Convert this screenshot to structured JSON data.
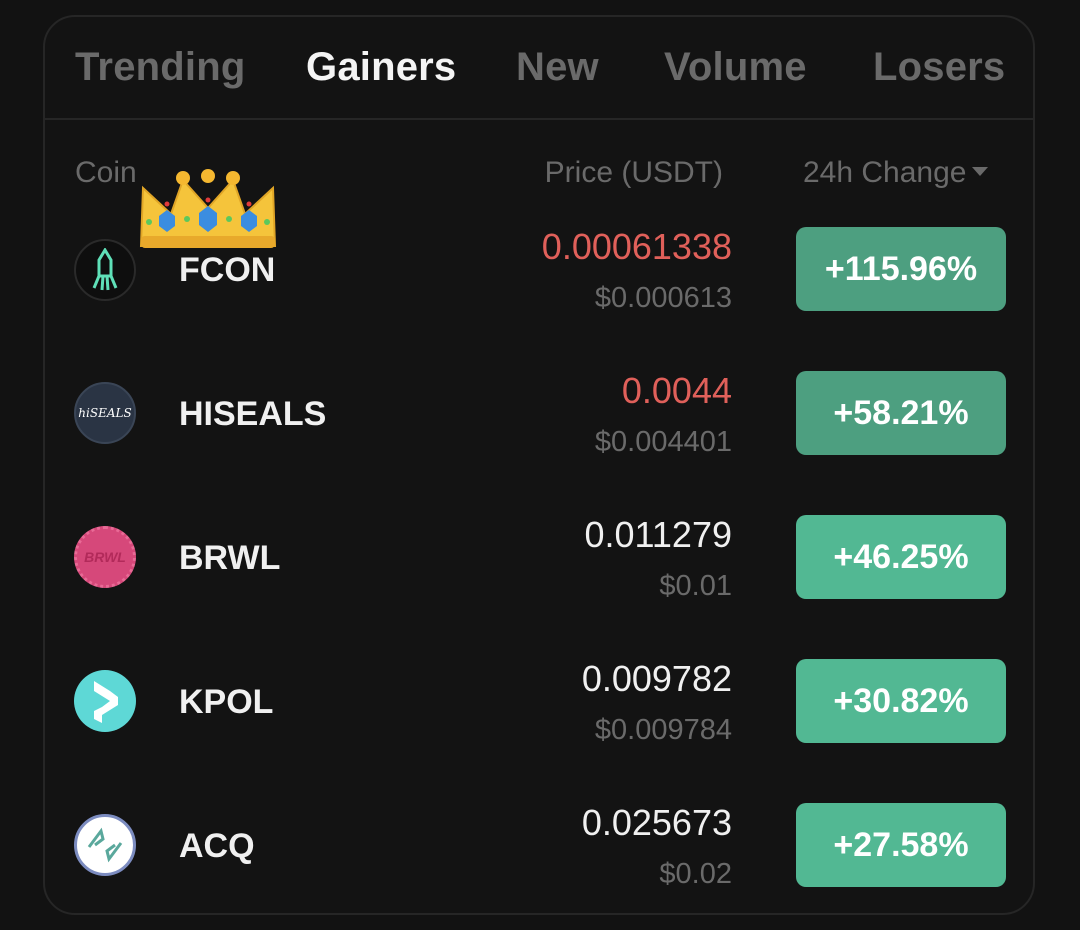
{
  "tabs": [
    {
      "label": "Trending",
      "active": false
    },
    {
      "label": "Gainers",
      "active": true
    },
    {
      "label": "New",
      "active": false
    },
    {
      "label": "Volume",
      "active": false
    },
    {
      "label": "Losers",
      "active": false
    }
  ],
  "columns": {
    "coin": "Coin",
    "price": "Price (USDT)",
    "change": "24h Change",
    "sort_icon": "caret-down-icon"
  },
  "colors": {
    "price_down": "#e0605a",
    "gain_badge": "#52b893",
    "background": "#121212"
  },
  "rows": [
    {
      "symbol": "FCON",
      "logo_icon": "rocket-icon",
      "price": "0.00061338",
      "price_color": "red",
      "usd": "$0.000613",
      "change": "+115.96%",
      "crown": true,
      "logo_text": ""
    },
    {
      "symbol": "HISEALS",
      "logo_icon": "hiseals-logo-icon",
      "price": "0.0044",
      "price_color": "red",
      "usd": "$0.004401",
      "change": "+58.21%",
      "logo_text": "hiSEALS"
    },
    {
      "symbol": "BRWL",
      "logo_icon": "brwl-coin-icon",
      "price": "0.011279",
      "price_color": "white",
      "usd": "$0.01",
      "change": "+46.25%",
      "logo_text": "BRWL"
    },
    {
      "symbol": "KPOL",
      "logo_icon": "kpol-logo-icon",
      "price": "0.009782",
      "price_color": "white",
      "usd": "$0.009784",
      "change": "+30.82%",
      "logo_text": ""
    },
    {
      "symbol": "ACQ",
      "logo_icon": "acq-logo-icon",
      "price": "0.025673",
      "price_color": "white",
      "usd": "$0.02",
      "change": "+27.58%",
      "logo_text": ""
    }
  ]
}
